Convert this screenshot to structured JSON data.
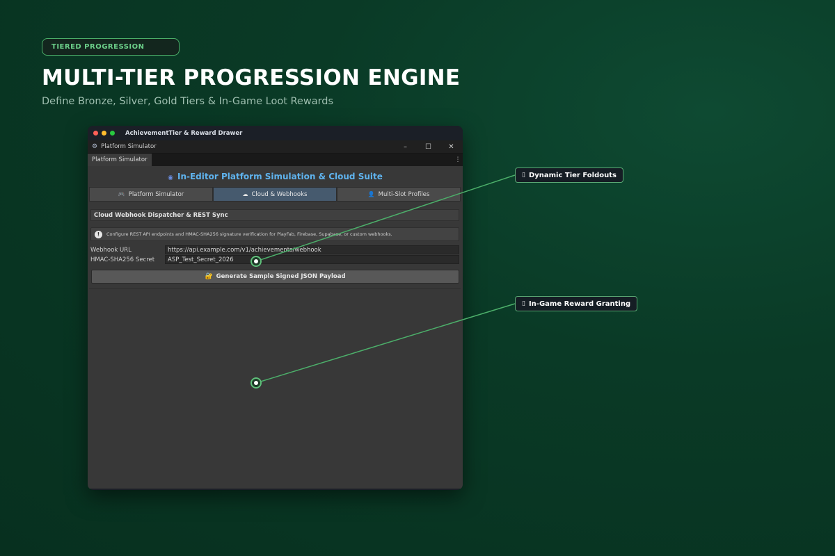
{
  "hero": {
    "badge": "TIERED PROGRESSION",
    "title": "MULTI-TIER PROGRESSION ENGINE",
    "subtitle": "Define Bronze, Silver, Gold Tiers & In-Game Loot Rewards"
  },
  "window": {
    "title": "AchievementTier & Reward Drawer",
    "chrome_title": "Platform Simulator",
    "tab_label": "Platform Simulator"
  },
  "panel": {
    "suite_title": "In-Editor Platform Simulation & Cloud Suite",
    "tabs": [
      {
        "label": "Platform Simulator",
        "active": false
      },
      {
        "label": "Cloud & Webhooks",
        "active": true
      },
      {
        "label": "Multi-Slot Profiles",
        "active": false
      }
    ],
    "section_header": "Cloud Webhook Dispatcher & REST Sync",
    "help_text": "Configure REST API endpoints and HMAC-SHA256 signature verification for PlayFab, Firebase, Supabase, or custom webhooks.",
    "fields": [
      {
        "label": "Webhook URL",
        "value": "https://api.example.com/v1/achievements/webhook"
      },
      {
        "label": "HMAC-SHA256 Secret",
        "value": "ASP_Test_Secret_2026"
      }
    ],
    "generate_button": "Generate Sample Signed JSON Payload"
  },
  "callouts": [
    {
      "label": "Dynamic Tier Foldouts"
    },
    {
      "label": "In-Game Reward Granting"
    }
  ],
  "colors": {
    "accent_green": "#4caf6a",
    "suite_title_blue": "#5fb3ee",
    "active_tab": "#465a6e"
  }
}
